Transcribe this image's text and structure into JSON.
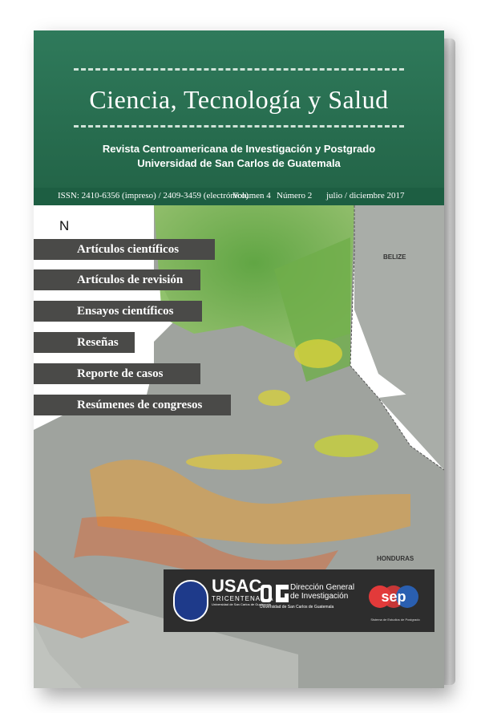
{
  "cover": {
    "title": "Ciencia, Tecnología y Salud",
    "subtitle_line1": "Revista Centroamericana de Investigación y Postgrado",
    "subtitle_line2": "Universidad de San Carlos de Guatemala",
    "issn": "ISSN: 2410-6356 (impreso) / 2409-3459 (electrónico)",
    "volume": "Volumen 4",
    "number": "Número 2",
    "period": "julio / diciembre  2017",
    "colors": {
      "header_green": "#2a7152",
      "section_gray": "#4a4a48",
      "infobar": "#1d5e42"
    }
  },
  "map": {
    "north_label": "N",
    "belize_label": "BELIZE",
    "honduras_label": "HONDURAS"
  },
  "sections": [
    {
      "label": "Artículos científicos"
    },
    {
      "label": "Artículos de revisión"
    },
    {
      "label": "Ensayos científicos"
    },
    {
      "label": "Reseñas"
    },
    {
      "label": "Reporte de casos"
    },
    {
      "label": "Resúmenes de congresos"
    }
  ],
  "logos": {
    "usac": "USAC",
    "usac_sub": "TRICENTENARIA",
    "usac_sub2": "Universidad de San Carlos de Guatemala",
    "dg_line1": "Dirección General",
    "dg_line2": "de Investigación",
    "dg_sub": "Universidad de San Carlos de Guatemala",
    "sep": "sep",
    "sep_sub": "Sistema de Estudios de Postgrado"
  }
}
